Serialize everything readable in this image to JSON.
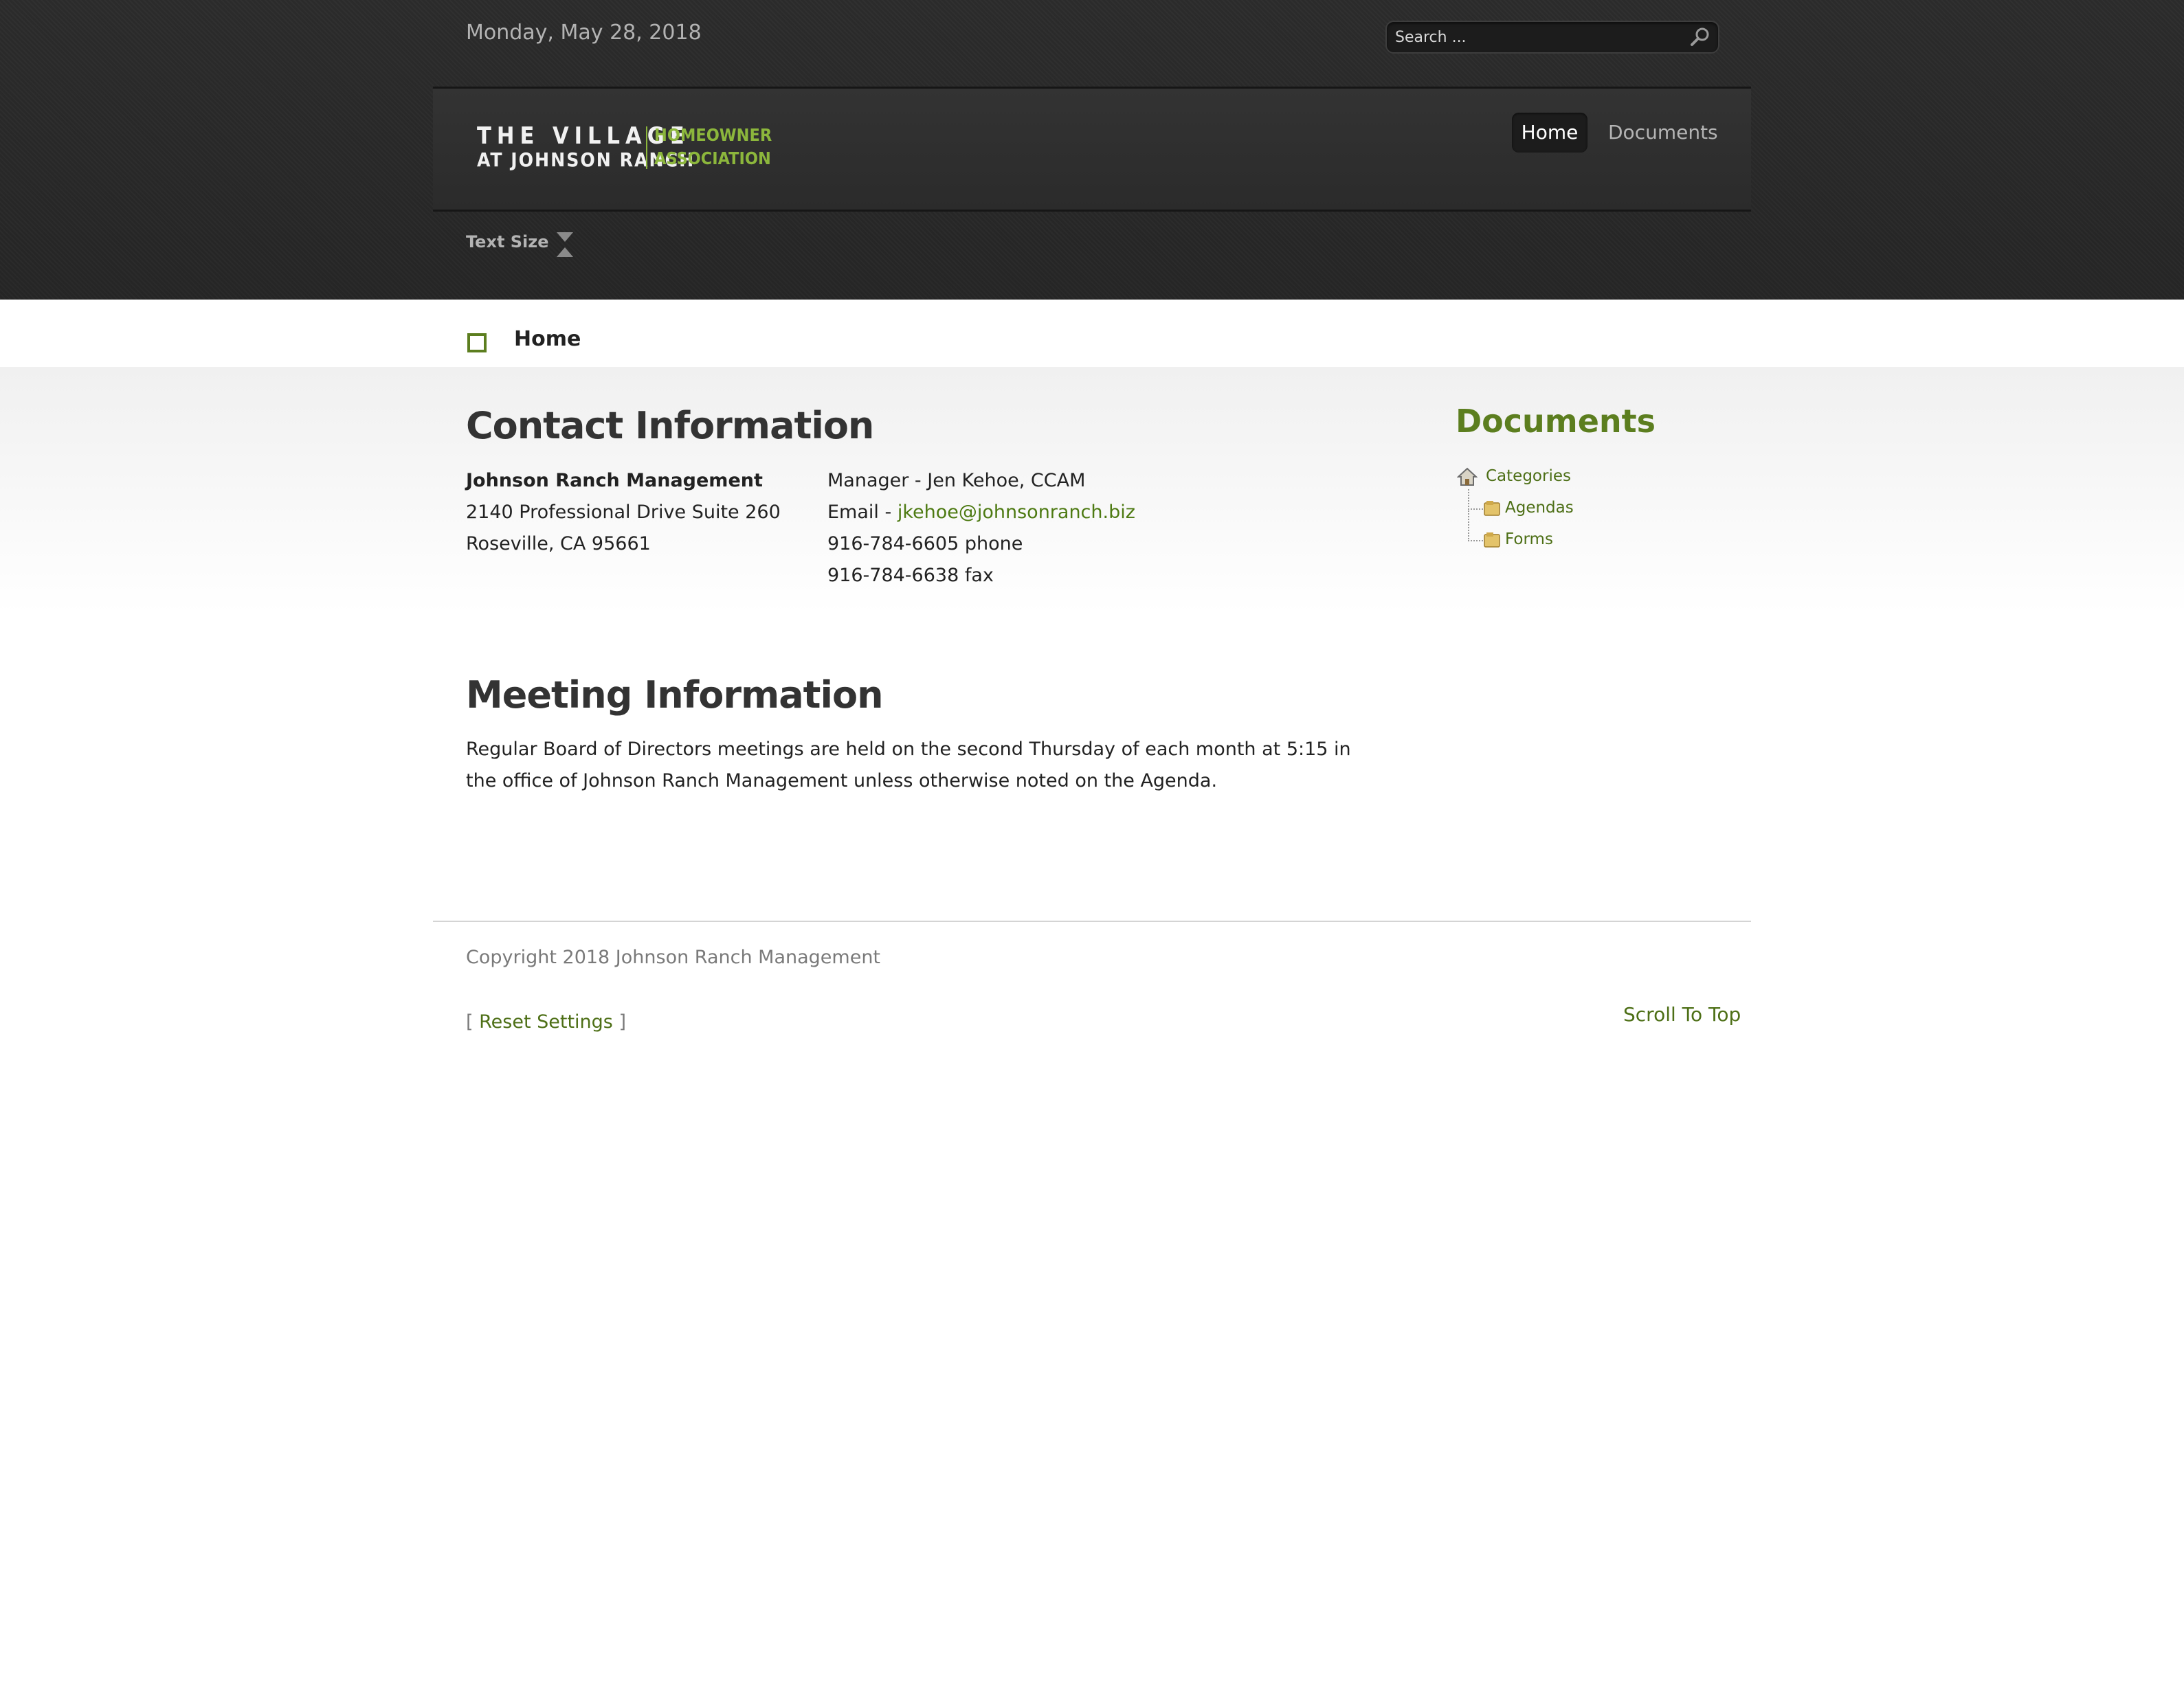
{
  "header": {
    "date": "Monday, May 28, 2018",
    "search_placeholder": "Search ...",
    "logo": {
      "line1": "THE VILLAGE",
      "line2": "AT JOHNSON RANCH",
      "tag1": "HOMEOWNER",
      "tag2": "ASSOCIATION"
    },
    "nav": [
      {
        "label": "Home",
        "active": true
      },
      {
        "label": "Documents",
        "active": false
      }
    ],
    "text_size_label": "Text Size"
  },
  "breadcrumb": {
    "label": "Home"
  },
  "contact": {
    "heading": "Contact Information",
    "company": "Johnson Ranch Management",
    "address1": "2140 Professional Drive Suite 260",
    "address2": "Roseville, CA 95661",
    "manager": "Manager - Jen Kehoe, CCAM",
    "email_prefix": "Email - ",
    "email": "jkehoe@johnsonranch.biz",
    "phone": "916-784-6605 phone",
    "fax": "916-784-6638 fax"
  },
  "meeting": {
    "heading": "Meeting Information",
    "text": "Regular Board of Directors meetings are held on the second Thursday of each month at 5:15 in the office of Johnson Ranch Management unless otherwise noted on the Agenda."
  },
  "sidebar": {
    "title": "Documents",
    "root": "Categories",
    "children": [
      "Agendas",
      "Forms"
    ]
  },
  "footer": {
    "copyright": "Copyright 2018 Johnson Ranch Management",
    "reset_open": "[ ",
    "reset_label": "Reset Settings",
    "reset_close": " ]",
    "scroll_top": "Scroll To Top"
  },
  "colors": {
    "accent": "#5c7e1f",
    "header_bg": "#2b2b2b",
    "logo_green": "#8cb63c"
  }
}
